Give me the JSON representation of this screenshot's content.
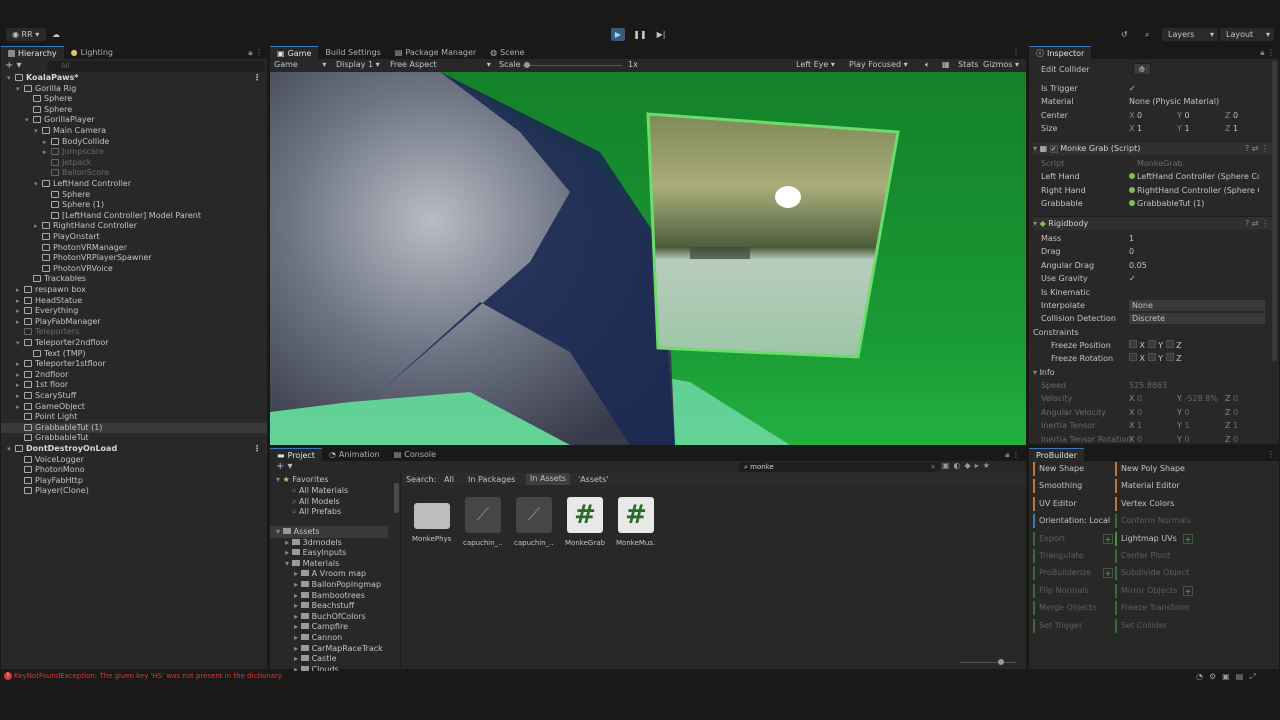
{
  "toolbar": {
    "account": "RR",
    "layers": "Layers",
    "layout": "Layout"
  },
  "hierarchy": {
    "tabs": [
      "Hierarchy",
      "Lighting"
    ],
    "search_placeholder": "All",
    "items": [
      {
        "label": "KoalaPaws*",
        "depth": 0,
        "arrow": "▾",
        "kind": "scene"
      },
      {
        "label": "Gorilla Rig",
        "depth": 1,
        "arrow": "▾",
        "kind": "normal"
      },
      {
        "label": "Sphere",
        "depth": 2,
        "arrow": "",
        "kind": "normal"
      },
      {
        "label": "Sphere",
        "depth": 2,
        "arrow": "",
        "kind": "normal"
      },
      {
        "label": "GorillaPlayer",
        "depth": 2,
        "arrow": "▾",
        "kind": "normal"
      },
      {
        "label": "Main Camera",
        "depth": 3,
        "arrow": "▾",
        "kind": "normal"
      },
      {
        "label": "BodyCollide",
        "depth": 4,
        "arrow": "▸",
        "kind": "normal"
      },
      {
        "label": "Jumpscare",
        "depth": 4,
        "arrow": "▸",
        "kind": "dim"
      },
      {
        "label": "Jetpack",
        "depth": 4,
        "arrow": "",
        "kind": "dim"
      },
      {
        "label": "BallonScore",
        "depth": 4,
        "arrow": "",
        "kind": "dim"
      },
      {
        "label": "LeftHand Controller",
        "depth": 3,
        "arrow": "▾",
        "kind": "normal"
      },
      {
        "label": "Sphere",
        "depth": 4,
        "arrow": "",
        "kind": "normal"
      },
      {
        "label": "Sphere (1)",
        "depth": 4,
        "arrow": "",
        "kind": "normal"
      },
      {
        "label": "[LeftHand Controller] Model Parent",
        "depth": 4,
        "arrow": "",
        "kind": "normal"
      },
      {
        "label": "RightHand Controller",
        "depth": 3,
        "arrow": "▸",
        "kind": "normal"
      },
      {
        "label": "PlayOnstart",
        "depth": 3,
        "arrow": "",
        "kind": "normal"
      },
      {
        "label": "PhotonVRManager",
        "depth": 3,
        "arrow": "",
        "kind": "normal"
      },
      {
        "label": "PhotonVRPlayerSpawner",
        "depth": 3,
        "arrow": "",
        "kind": "normal"
      },
      {
        "label": "PhotonVRVoice",
        "depth": 3,
        "arrow": "",
        "kind": "normal"
      },
      {
        "label": "Trackables",
        "depth": 2,
        "arrow": "",
        "kind": "normal"
      },
      {
        "label": "respawn box",
        "depth": 1,
        "arrow": "▸",
        "kind": "normal"
      },
      {
        "label": "HeadStatue",
        "depth": 1,
        "arrow": "▸",
        "kind": "normal"
      },
      {
        "label": "Everything",
        "depth": 1,
        "arrow": "▸",
        "kind": "normal"
      },
      {
        "label": "PlayFabManager",
        "depth": 1,
        "arrow": "▸",
        "kind": "normal"
      },
      {
        "label": "Teleporters",
        "depth": 1,
        "arrow": "",
        "kind": "dim"
      },
      {
        "label": "Teleporter2ndfloor",
        "depth": 1,
        "arrow": "▾",
        "kind": "normal"
      },
      {
        "label": "Text (TMP)",
        "depth": 2,
        "arrow": "",
        "kind": "normal"
      },
      {
        "label": "Teleporter1stfloor",
        "depth": 1,
        "arrow": "▸",
        "kind": "normal"
      },
      {
        "label": "2ndfloor",
        "depth": 1,
        "arrow": "▸",
        "kind": "normal"
      },
      {
        "label": "1st floor",
        "depth": 1,
        "arrow": "▸",
        "kind": "normal"
      },
      {
        "label": "ScaryStuff",
        "depth": 1,
        "arrow": "▸",
        "kind": "normal"
      },
      {
        "label": "GameObject",
        "depth": 1,
        "arrow": "▸",
        "kind": "normal"
      },
      {
        "label": "Point Light",
        "depth": 1,
        "arrow": "",
        "kind": "normal"
      },
      {
        "label": "GrabbableTut (1)",
        "depth": 1,
        "arrow": "",
        "kind": "sel"
      },
      {
        "label": "GrabbableTut",
        "depth": 1,
        "arrow": "",
        "kind": "normal"
      },
      {
        "label": "DontDestroyOnLoad",
        "depth": 0,
        "arrow": "▾",
        "kind": "scene"
      },
      {
        "label": "VoiceLogger",
        "depth": 1,
        "arrow": "",
        "kind": "normal"
      },
      {
        "label": "PhotonMono",
        "depth": 1,
        "arrow": "",
        "kind": "normal"
      },
      {
        "label": "PlayFabHttp",
        "depth": 1,
        "arrow": "",
        "kind": "normal"
      },
      {
        "label": "Player(Clone)",
        "depth": 1,
        "arrow": "",
        "kind": "normal"
      }
    ]
  },
  "game": {
    "tabs": [
      "Game",
      "Build Settings",
      "Package Manager",
      "Scene"
    ],
    "mode": "Game",
    "display": "Display 1",
    "aspect": "Free Aspect",
    "scale_label": "Scale",
    "scale_value": "1x",
    "eye": "Left Eye",
    "play_mode": "Play Focused",
    "stats": "Stats",
    "gizmos": "Gizmos"
  },
  "inspector": {
    "tab": "Inspector",
    "edit_collider": "Edit Collider",
    "collider_rows": [
      {
        "label": "Is Trigger",
        "value": "✓"
      },
      {
        "label": "Material",
        "value": "None (Physic Material)"
      },
      {
        "label": "Center",
        "x": "0",
        "y": "0",
        "z": "0"
      },
      {
        "label": "Size",
        "x": "1",
        "y": "1",
        "z": "1"
      }
    ],
    "script_title": "Monke Grab (Script)",
    "script_rows": [
      {
        "label": "Script",
        "value": "MonkeGrab",
        "dim": true
      },
      {
        "label": "Left Hand",
        "value": "LeftHand Controller (Sphere Co"
      },
      {
        "label": "Right Hand",
        "value": "RightHand Controller (Sphere C"
      },
      {
        "label": "Grabbable",
        "value": "GrabbableTut (1)"
      }
    ],
    "rigidbody_title": "Rigidbody",
    "rigidbody_rows": [
      {
        "label": "Mass",
        "value": "1"
      },
      {
        "label": "Drag",
        "value": "0"
      },
      {
        "label": "Angular Drag",
        "value": "0.05"
      },
      {
        "label": "Use Gravity",
        "value": "✓"
      },
      {
        "label": "Is Kinematic",
        "value": ""
      },
      {
        "label": "Interpolate",
        "value": "None"
      },
      {
        "label": "Collision Detection",
        "value": "Discrete"
      },
      {
        "label": "Constraints",
        "value": ""
      }
    ],
    "freeze_position": "Freeze Position",
    "freeze_rotation": "Freeze Rotation",
    "info": "Info",
    "info_rows": [
      {
        "label": "Speed",
        "x": "525.8863",
        "y": "",
        "z": ""
      },
      {
        "label": "Velocity",
        "x": "0",
        "y": "-528.8%",
        "z": "0"
      },
      {
        "label": "Angular Velocity",
        "x": "0",
        "y": "0",
        "z": "0"
      },
      {
        "label": "Inertia Tensor",
        "x": "1",
        "y": "1",
        "z": "1"
      },
      {
        "label": "Inertia Tensor Rotation",
        "x": "0",
        "y": "0",
        "z": "0"
      }
    ]
  },
  "project": {
    "tabs": [
      "Project",
      "Animation",
      "Console"
    ],
    "search_value": "monke",
    "favorites_title": "Favorites",
    "favorites": [
      "All Materials",
      "All Models",
      "All Prefabs"
    ],
    "tree": [
      {
        "label": "Assets",
        "depth": 0
      },
      {
        "label": "3dmodels",
        "depth": 1
      },
      {
        "label": "EasyInputs",
        "depth": 1
      },
      {
        "label": "Materials",
        "depth": 1
      },
      {
        "label": "A Vroom map",
        "depth": 2
      },
      {
        "label": "BallonPopingmap",
        "depth": 2
      },
      {
        "label": "Bambootrees",
        "depth": 2
      },
      {
        "label": "Beachstuff",
        "depth": 2
      },
      {
        "label": "BuchOfColors",
        "depth": 2
      },
      {
        "label": "Campfire",
        "depth": 2
      },
      {
        "label": "Cannon",
        "depth": 2
      },
      {
        "label": "CarMapRaceTrack",
        "depth": 2
      },
      {
        "label": "Castle",
        "depth": 2
      },
      {
        "label": "Clouds",
        "depth": 2
      }
    ],
    "search_label": "Search:",
    "filters": [
      "All",
      "In Packages",
      "In Assets",
      "'Assets'"
    ],
    "assets": [
      {
        "name": "MonkePhys...",
        "icon": "folder"
      },
      {
        "name": "capuchin_...",
        "icon": "model"
      },
      {
        "name": "capuchin_...",
        "icon": "model"
      },
      {
        "name": "MonkeGrab",
        "icon": "script"
      },
      {
        "name": "MonkeMus...",
        "icon": "script"
      }
    ]
  },
  "probuilder": {
    "title": "ProBuilder",
    "left": [
      {
        "label": "New Shape",
        "color": "#c8732d",
        "dim": false
      },
      {
        "label": "Smoothing",
        "color": "#c8732d",
        "dim": false
      },
      {
        "label": "UV Editor",
        "color": "#c8732d",
        "dim": false
      },
      {
        "label": "Orientation: Local",
        "color": "#3a79bb",
        "dim": false
      },
      {
        "label": "Export",
        "color": "#3a6a3a",
        "dim": true
      },
      {
        "label": "Triangulate",
        "color": "#3a6a3a",
        "dim": true
      },
      {
        "label": "ProBuilderize",
        "color": "#3a6a3a",
        "dim": true
      },
      {
        "label": "Flip Normals",
        "color": "#3a6a3a",
        "dim": true
      },
      {
        "label": "Merge Objects",
        "color": "#3a6a3a",
        "dim": true
      },
      {
        "label": "Set Trigger",
        "color": "#3a6a3a",
        "dim": true
      }
    ],
    "right": [
      {
        "label": "New Poly Shape",
        "color": "#c8732d",
        "dim": false
      },
      {
        "label": "Material Editor",
        "color": "#c8732d",
        "dim": false
      },
      {
        "label": "Vertex Colors",
        "color": "#c8732d",
        "dim": false
      },
      {
        "label": "Conform Normals",
        "color": "#3a6a3a",
        "dim": true
      },
      {
        "label": "Lightmap UVs",
        "color": "#4c8f3c",
        "dim": false
      },
      {
        "label": "Center Pivot",
        "color": "#3a6a3a",
        "dim": true
      },
      {
        "label": "Subdivide Object",
        "color": "#3a6a3a",
        "dim": true
      },
      {
        "label": "Mirror Objects",
        "color": "#3a6a3a",
        "dim": true
      },
      {
        "label": "Freeze Transform",
        "color": "#3a6a3a",
        "dim": true
      },
      {
        "label": "Set Collider",
        "color": "#3a6a3a",
        "dim": true
      }
    ]
  },
  "status": {
    "error": "KeyNotFoundException: The given key 'HS' was not present in the dictionary.",
    "error_color": "#d13b3b"
  }
}
